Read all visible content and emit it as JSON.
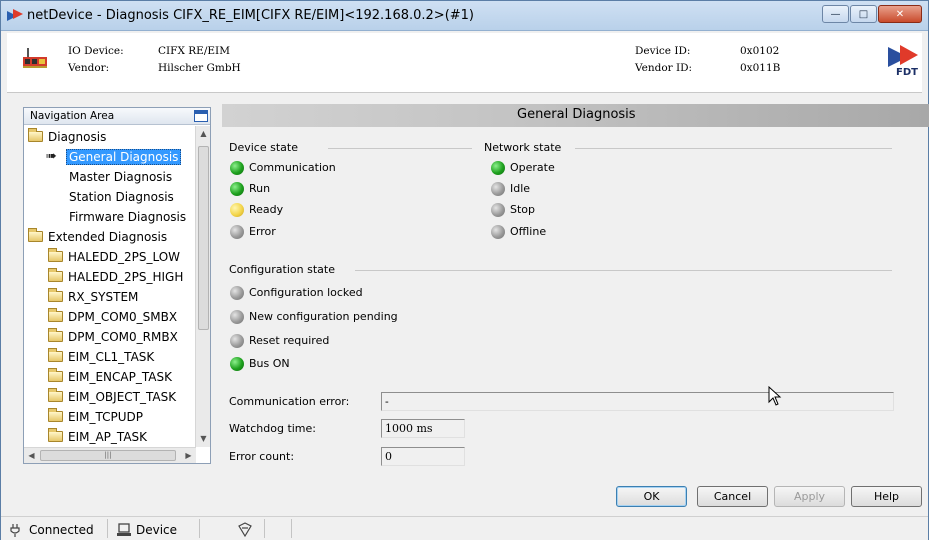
{
  "window": {
    "title": "netDevice - Diagnosis CIFX_RE_EIM[CIFX RE/EIM]<192.168.0.2>(#1)",
    "controls": [
      "minimize",
      "maximize",
      "close"
    ]
  },
  "header": {
    "io_device_label": "IO Device:",
    "io_device_value": "CIFX RE/EIM",
    "vendor_label": "Vendor:",
    "vendor_value": "Hilscher GmbH",
    "device_id_label": "Device ID:",
    "device_id_value": "0x0102",
    "vendor_id_label": "Vendor ID:",
    "vendor_id_value": "0x011B",
    "fdt_logo_text": "FDT"
  },
  "navigation": {
    "title": "Navigation Area",
    "items": [
      {
        "label": "Diagnosis",
        "level": 0,
        "icon": "folder-icon"
      },
      {
        "label": "General Diagnosis",
        "level": 1,
        "selected": true,
        "icon": "arrow-icon"
      },
      {
        "label": "Master Diagnosis",
        "level": 1
      },
      {
        "label": "Station Diagnosis",
        "level": 1
      },
      {
        "label": "Firmware Diagnosis",
        "level": 1
      },
      {
        "label": "Extended Diagnosis",
        "level": 0,
        "icon": "folder-icon"
      },
      {
        "label": "HALEDD_2PS_LOW",
        "level": 1,
        "icon": "folder-icon"
      },
      {
        "label": "HALEDD_2PS_HIGH",
        "level": 1,
        "icon": "folder-icon"
      },
      {
        "label": "RX_SYSTEM",
        "level": 1,
        "icon": "folder-icon"
      },
      {
        "label": "DPM_COM0_SMBX",
        "level": 1,
        "icon": "folder-icon"
      },
      {
        "label": "DPM_COM0_RMBX",
        "level": 1,
        "icon": "folder-icon"
      },
      {
        "label": "EIM_CL1_TASK",
        "level": 1,
        "icon": "folder-icon"
      },
      {
        "label": "EIM_ENCAP_TASK",
        "level": 1,
        "icon": "folder-icon"
      },
      {
        "label": "EIM_OBJECT_TASK",
        "level": 1,
        "icon": "folder-icon"
      },
      {
        "label": "EIM_TCPUDP",
        "level": 1,
        "icon": "folder-icon"
      },
      {
        "label": "EIM_AP_TASK",
        "level": 1,
        "icon": "folder-icon"
      }
    ]
  },
  "main": {
    "title": "General Diagnosis",
    "device_state": {
      "title": "Device state",
      "items": [
        {
          "label": "Communication",
          "status": "green"
        },
        {
          "label": "Run",
          "status": "green"
        },
        {
          "label": "Ready",
          "status": "yellow"
        },
        {
          "label": "Error",
          "status": "gray"
        }
      ]
    },
    "network_state": {
      "title": "Network state",
      "items": [
        {
          "label": "Operate",
          "status": "green"
        },
        {
          "label": "Idle",
          "status": "gray"
        },
        {
          "label": "Stop",
          "status": "gray"
        },
        {
          "label": "Offline",
          "status": "gray"
        }
      ]
    },
    "configuration_state": {
      "title": "Configuration state",
      "items": [
        {
          "label": "Configuration locked",
          "status": "gray"
        },
        {
          "label": "New configuration pending",
          "status": "gray"
        },
        {
          "label": "Reset required",
          "status": "gray"
        },
        {
          "label": "Bus ON",
          "status": "green"
        }
      ]
    },
    "communication_error_label": "Communication error:",
    "communication_error_value": "-",
    "watchdog_time_label": "Watchdog time:",
    "watchdog_time_value": "1000  ms",
    "error_count_label": "Error count:",
    "error_count_value": "0"
  },
  "buttons": {
    "ok": "OK",
    "cancel": "Cancel",
    "apply": "Apply",
    "help": "Help"
  },
  "statusbar": {
    "connected": "Connected",
    "device": "Device"
  },
  "colors": {
    "led_green": "#1ea01e",
    "led_gray": "#9a9a9a",
    "led_yellow": "#f3d54a",
    "selection": "#3399ff"
  }
}
